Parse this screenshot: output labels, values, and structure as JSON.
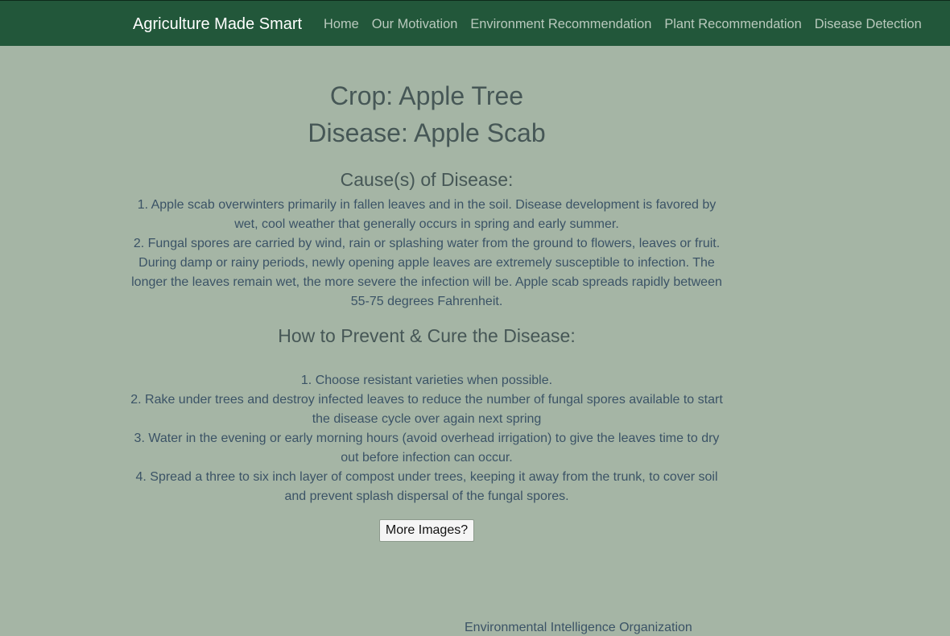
{
  "navbar": {
    "brand": "Agriculture Made Smart",
    "links": [
      "Home",
      "Our Motivation",
      "Environment Recommendation",
      "Plant Recommendation",
      "Disease Detection"
    ]
  },
  "main": {
    "crop": "Crop: Apple Tree",
    "disease": "Disease: Apple Scab",
    "cause_heading": "Cause(s) of Disease:",
    "causes": [
      "1. Apple scab overwinters primarily in fallen leaves and in the soil. Disease development is favored by wet, cool weather that generally occurs in spring and early summer.",
      "2. Fungal spores are carried by wind, rain or splashing water from the ground to flowers, leaves or fruit. During damp or rainy periods, newly opening apple leaves are extremely susceptible to infection. The longer the leaves remain wet, the more severe the infection will be. Apple scab spreads rapidly between 55-75 degrees Fahrenheit."
    ],
    "prevent_heading": "How to Prevent & Cure the Disease:",
    "prevention": [
      "1. Choose resistant varieties when possible.",
      "2. Rake under trees and destroy infected leaves to reduce the number of fungal spores available to start the disease cycle over again next spring",
      "3. Water in the evening or early morning hours (avoid overhead irrigation) to give the leaves time to dry out before infection can occur.",
      "4. Spread a three to six inch layer of compost under trees, keeping it away from the trunk, to cover soil and prevent splash dispersal of the fungal spores."
    ],
    "more_images_button": "More Images?"
  },
  "footer": {
    "text": "Environmental Intelligence Organization"
  }
}
